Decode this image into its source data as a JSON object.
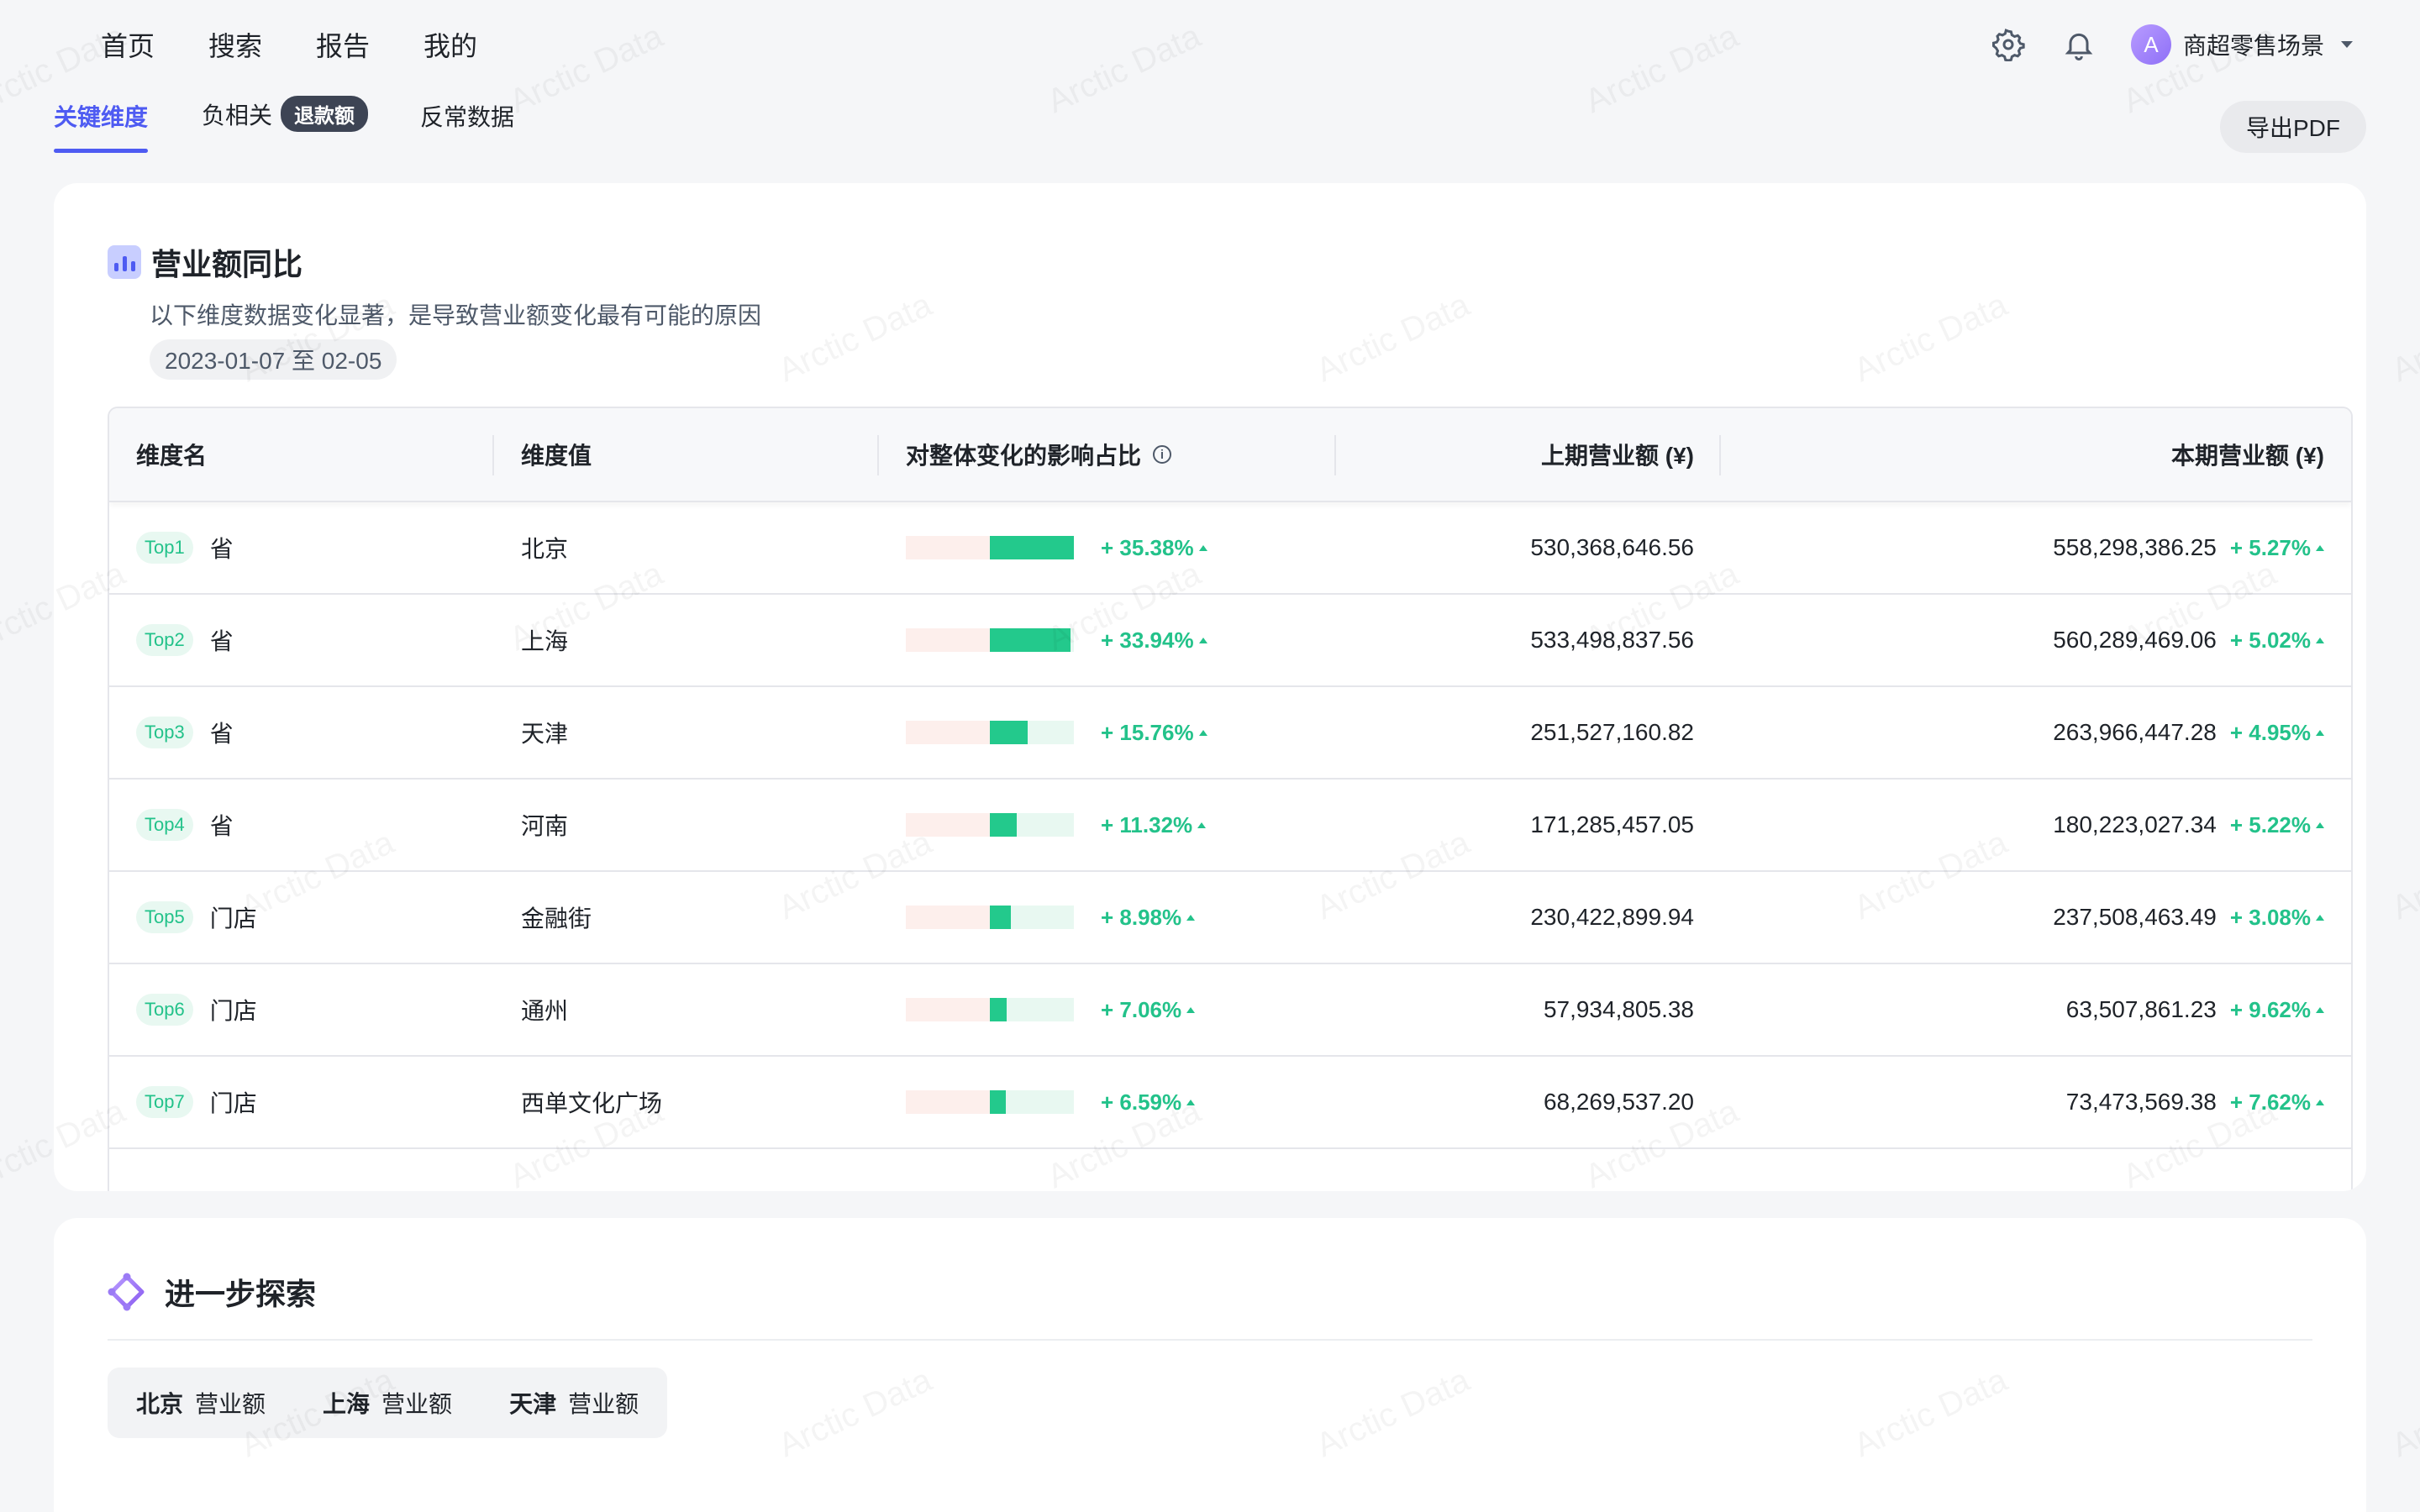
{
  "nav": {
    "items": [
      "首页",
      "搜索",
      "报告",
      "我的"
    ],
    "user": {
      "avatar_letter": "A",
      "name": "商超零售场景"
    },
    "icons": [
      "gear-icon",
      "bell-icon"
    ]
  },
  "subtabs": {
    "items": [
      {
        "label": "关键维度",
        "active": true
      },
      {
        "label": "负相关",
        "badge": "退款额"
      },
      {
        "label": "反常数据"
      }
    ],
    "export_label": "导出PDF"
  },
  "watermark_text": "Arctic Data",
  "card": {
    "title": "营业额同比",
    "subtitle": "以下维度数据变化显著，是导致营业额变化最有可能的原因",
    "date_range": "2023-01-07 至 02-05",
    "columns": [
      "维度名",
      "维度值",
      "对整体变化的影响占比",
      "上期营业额 (¥)",
      "本期营业额 (¥)"
    ],
    "info_icon": "i",
    "rows": [
      {
        "rank": "Top1",
        "dim": "省",
        "value": "北京",
        "impact": 35.38,
        "impact_label": "+ 35.38%",
        "prev": "530,368,646.56",
        "curr": "558,298,386.25",
        "change": "+ 5.27%"
      },
      {
        "rank": "Top2",
        "dim": "省",
        "value": "上海",
        "impact": 33.94,
        "impact_label": "+ 33.94%",
        "prev": "533,498,837.56",
        "curr": "560,289,469.06",
        "change": "+ 5.02%"
      },
      {
        "rank": "Top3",
        "dim": "省",
        "value": "天津",
        "impact": 15.76,
        "impact_label": "+ 15.76%",
        "prev": "251,527,160.82",
        "curr": "263,966,447.28",
        "change": "+ 4.95%"
      },
      {
        "rank": "Top4",
        "dim": "省",
        "value": "河南",
        "impact": 11.32,
        "impact_label": "+ 11.32%",
        "prev": "171,285,457.05",
        "curr": "180,223,027.34",
        "change": "+ 5.22%"
      },
      {
        "rank": "Top5",
        "dim": "门店",
        "value": "金融街",
        "impact": 8.98,
        "impact_label": "+ 8.98%",
        "prev": "230,422,899.94",
        "curr": "237,508,463.49",
        "change": "+ 3.08%"
      },
      {
        "rank": "Top6",
        "dim": "门店",
        "value": "通州",
        "impact": 7.06,
        "impact_label": "+ 7.06%",
        "prev": "57,934,805.38",
        "curr": "63,507,861.23",
        "change": "+ 9.62%"
      },
      {
        "rank": "Top7",
        "dim": "门店",
        "value": "西单文化广场",
        "impact": 6.59,
        "impact_label": "+ 6.59%",
        "prev": "68,269,537.20",
        "curr": "73,473,569.38",
        "change": "+ 7.62%"
      }
    ]
  },
  "explore": {
    "title": "进一步探索",
    "chips": [
      {
        "entity": "北京",
        "metric": "营业额"
      },
      {
        "entity": "上海",
        "metric": "营业额"
      },
      {
        "entity": "天津",
        "metric": "营业额"
      }
    ]
  },
  "colors": {
    "accent": "#4e5bf2",
    "positive": "#23c28a",
    "positive_bar": "#23c98c",
    "negative_bg": "#fdefec"
  }
}
